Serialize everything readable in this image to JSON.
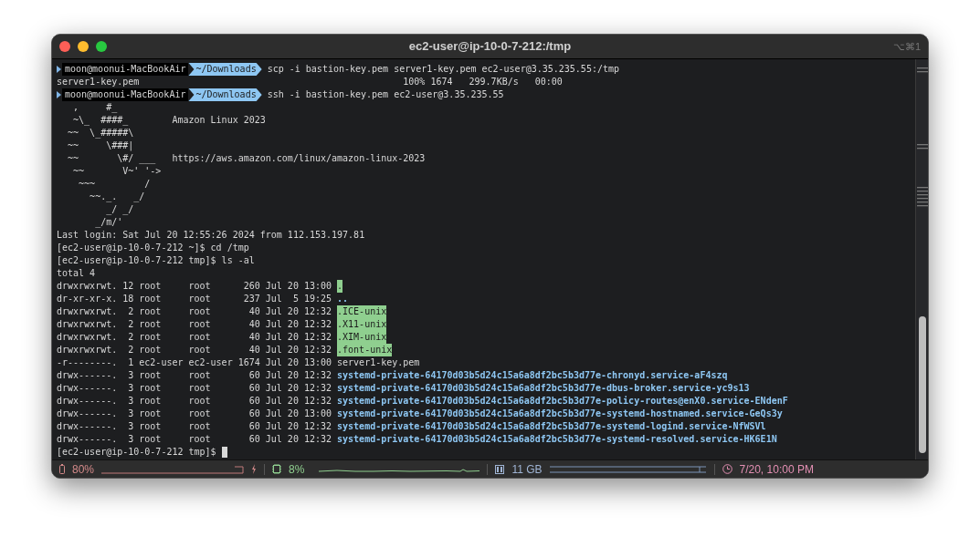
{
  "window": {
    "title": "ec2-user@ip-10-0-7-212:/tmp",
    "shortcut": "⌥⌘1"
  },
  "lines": [
    {
      "kind": "prompt",
      "user": "moon@moonui-MacBookAir",
      "dir": "~/Downloads",
      "command": "scp -i bastion-key.pem server1-key.pem ec2-user@3.35.235.55:/tmp"
    },
    {
      "kind": "output",
      "text": "server1-key.pem                                                100% 1674   299.7KB/s   00:00"
    },
    {
      "kind": "prompt",
      "user": "moon@moonui-MacBookAir",
      "dir": "~/Downloads",
      "command": "ssh -i bastion-key.pem ec2-user@3.35.235.55"
    },
    {
      "kind": "output",
      "text": "   ,     #_"
    },
    {
      "kind": "output",
      "text": "   ~\\_  ####_        Amazon Linux 2023"
    },
    {
      "kind": "output",
      "text": "  ~~  \\_#####\\"
    },
    {
      "kind": "output",
      "text": "  ~~     \\###|"
    },
    {
      "kind": "output",
      "text": "  ~~       \\#/ ___   https://aws.amazon.com/linux/amazon-linux-2023"
    },
    {
      "kind": "output",
      "text": "   ~~       V~' '->"
    },
    {
      "kind": "output",
      "text": "    ~~~         /"
    },
    {
      "kind": "output",
      "text": "      ~~._.   _/"
    },
    {
      "kind": "output",
      "text": "         _/ _/"
    },
    {
      "kind": "output",
      "text": "       _/m/'"
    },
    {
      "kind": "output",
      "text": "Last login: Sat Jul 20 12:55:26 2024 from 112.153.197.81"
    },
    {
      "kind": "output",
      "text": "[ec2-user@ip-10-0-7-212 ~]$ cd /tmp"
    },
    {
      "kind": "output",
      "text": "[ec2-user@ip-10-0-7-212 tmp]$ ls -al"
    },
    {
      "kind": "output",
      "text": "total 4"
    },
    {
      "kind": "sticky",
      "info": "drwxrwxrwt. 12 root     root      260 Jul 20 13:00",
      "name": "."
    },
    {
      "kind": "dir",
      "info": "dr-xr-xr-x. 18 root     root      237 Jul  5 19:25",
      "name": ".."
    },
    {
      "kind": "sticky",
      "info": "drwxrwxrwt.  2 root     root       40 Jul 20 12:32",
      "name": ".ICE-unix"
    },
    {
      "kind": "sticky",
      "info": "drwxrwxrwt.  2 root     root       40 Jul 20 12:32",
      "name": ".X11-unix"
    },
    {
      "kind": "sticky",
      "info": "drwxrwxrwt.  2 root     root       40 Jul 20 12:32",
      "name": ".XIM-unix"
    },
    {
      "kind": "sticky",
      "info": "drwxrwxrwt.  2 root     root       40 Jul 20 12:32",
      "name": ".font-unix"
    },
    {
      "kind": "file",
      "info": "-r--------.  1 ec2-user ec2-user 1674 Jul 20 13:00",
      "name": "server1-key.pem"
    },
    {
      "kind": "dir",
      "info": "drwx------.  3 root     root       60 Jul 20 12:32",
      "name": "systemd-private-64170d03b5d24c15a6a8df2bc5b3d77e-chronyd.service-aF4szq"
    },
    {
      "kind": "dir",
      "info": "drwx------.  3 root     root       60 Jul 20 12:32",
      "name": "systemd-private-64170d03b5d24c15a6a8df2bc5b3d77e-dbus-broker.service-yc9s13"
    },
    {
      "kind": "dir",
      "info": "drwx------.  3 root     root       60 Jul 20 12:32",
      "name": "systemd-private-64170d03b5d24c15a6a8df2bc5b3d77e-policy-routes@enX0.service-ENdenF"
    },
    {
      "kind": "dir",
      "info": "drwx------.  3 root     root       60 Jul 20 13:00",
      "name": "systemd-private-64170d03b5d24c15a6a8df2bc5b3d77e-systemd-hostnamed.service-GeQs3y"
    },
    {
      "kind": "dir",
      "info": "drwx------.  3 root     root       60 Jul 20 12:32",
      "name": "systemd-private-64170d03b5d24c15a6a8df2bc5b3d77e-systemd-logind.service-NfWSVl"
    },
    {
      "kind": "dir",
      "info": "drwx------.  3 root     root       60 Jul 20 12:32",
      "name": "systemd-private-64170d03b5d24c15a6a8df2bc5b3d77e-systemd-resolved.service-HK6E1N"
    },
    {
      "kind": "cursor",
      "text": "[ec2-user@ip-10-0-7-212 tmp]$"
    }
  ],
  "status_bar": {
    "battery": "80%",
    "cpu": "8%",
    "memory": "11 GB",
    "clock": "7/20, 10:00 PM"
  }
}
